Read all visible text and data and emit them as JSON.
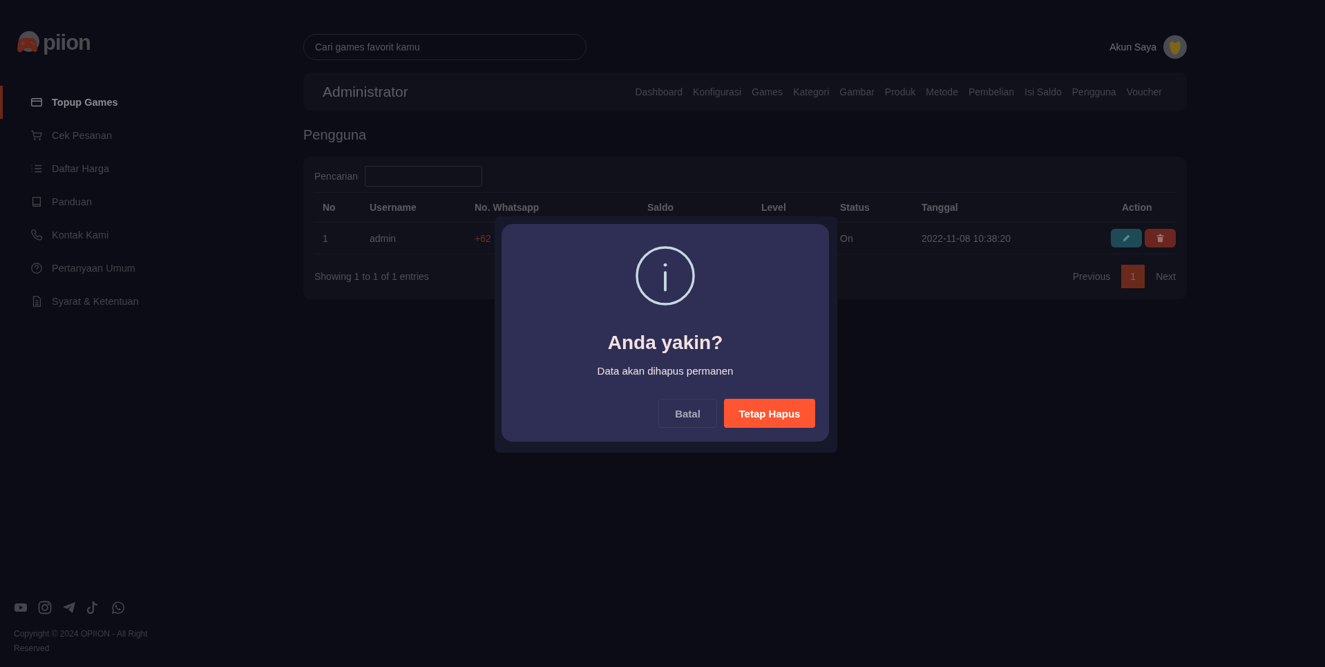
{
  "logo": {
    "text": "piion"
  },
  "sidebar": {
    "items": [
      {
        "label": "Topup Games",
        "selected": true
      },
      {
        "label": "Cek Pesanan",
        "selected": false
      },
      {
        "label": "Daftar Harga",
        "selected": false
      },
      {
        "label": "Panduan",
        "selected": false
      },
      {
        "label": "Kontak Kami",
        "selected": false
      },
      {
        "label": "Pertanyaan Umum",
        "selected": false
      },
      {
        "label": "Syarat & Ketentuan",
        "selected": false
      }
    ]
  },
  "copyright": "Copyright © 2024 OPIION - All Right Reserved",
  "search": {
    "placeholder": "Cari games favorit kamu"
  },
  "account": {
    "label": "Akun Saya"
  },
  "admin_bar": {
    "title": "Administrator",
    "nav": [
      "Dashboard",
      "Konfigurasi",
      "Games",
      "Kategori",
      "Gambar",
      "Produk",
      "Metode",
      "Pembelian",
      "Isi Saldo",
      "Pengguna",
      "Voucher"
    ]
  },
  "page_title": "Pengguna",
  "table": {
    "search_label": "Pencarian",
    "columns": [
      "No",
      "Username",
      "No. Whatsapp",
      "Saldo",
      "Level",
      "Status",
      "Tanggal",
      "Action"
    ],
    "rows": [
      {
        "no": "1",
        "username": "admin",
        "whatsapp": "+62",
        "status": "On",
        "tanggal": "2022-11-08 10:38:20"
      }
    ],
    "info": "Showing 1 to 1 of 1 entries",
    "pagination": {
      "previous": "Previous",
      "pages": [
        {
          "label": "1",
          "selected": true
        }
      ],
      "next": "Next"
    }
  },
  "dialog": {
    "title": "Anda yakin?",
    "message": "Data akan dihapus permanen",
    "buttons": [
      {
        "label": "Batal",
        "kind": "cancel"
      },
      {
        "label": "Tetap Hapus",
        "kind": "confirm"
      }
    ]
  }
}
